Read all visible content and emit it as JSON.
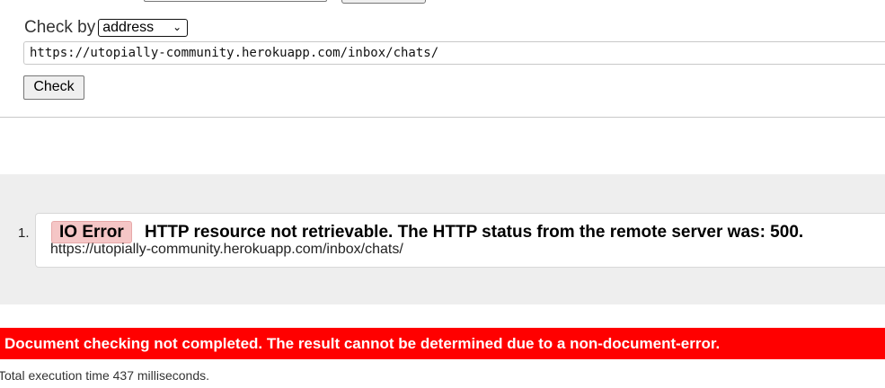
{
  "form": {
    "checkby_label": "Check by",
    "checkby_selected": "address",
    "checkby_chevron": "⌄",
    "url_value": "https://utopially-community.herokuapp.com/inbox/chats/",
    "check_button": "Check"
  },
  "results": [
    {
      "index": "1.",
      "badge": "IO Error",
      "message": "HTTP resource not retrievable. The HTTP status from the remote server was: 500.",
      "url": "https://utopially-community.herokuapp.com/inbox/chats/"
    }
  ],
  "status": {
    "banner": "Document checking not completed. The result cannot be determined due to a non-document-error.",
    "execution_time": "Total execution time 437 milliseconds."
  },
  "colors": {
    "error_banner": "#ff0000",
    "badge_bg": "#f5c6c6",
    "results_bg": "#eeeeee"
  }
}
